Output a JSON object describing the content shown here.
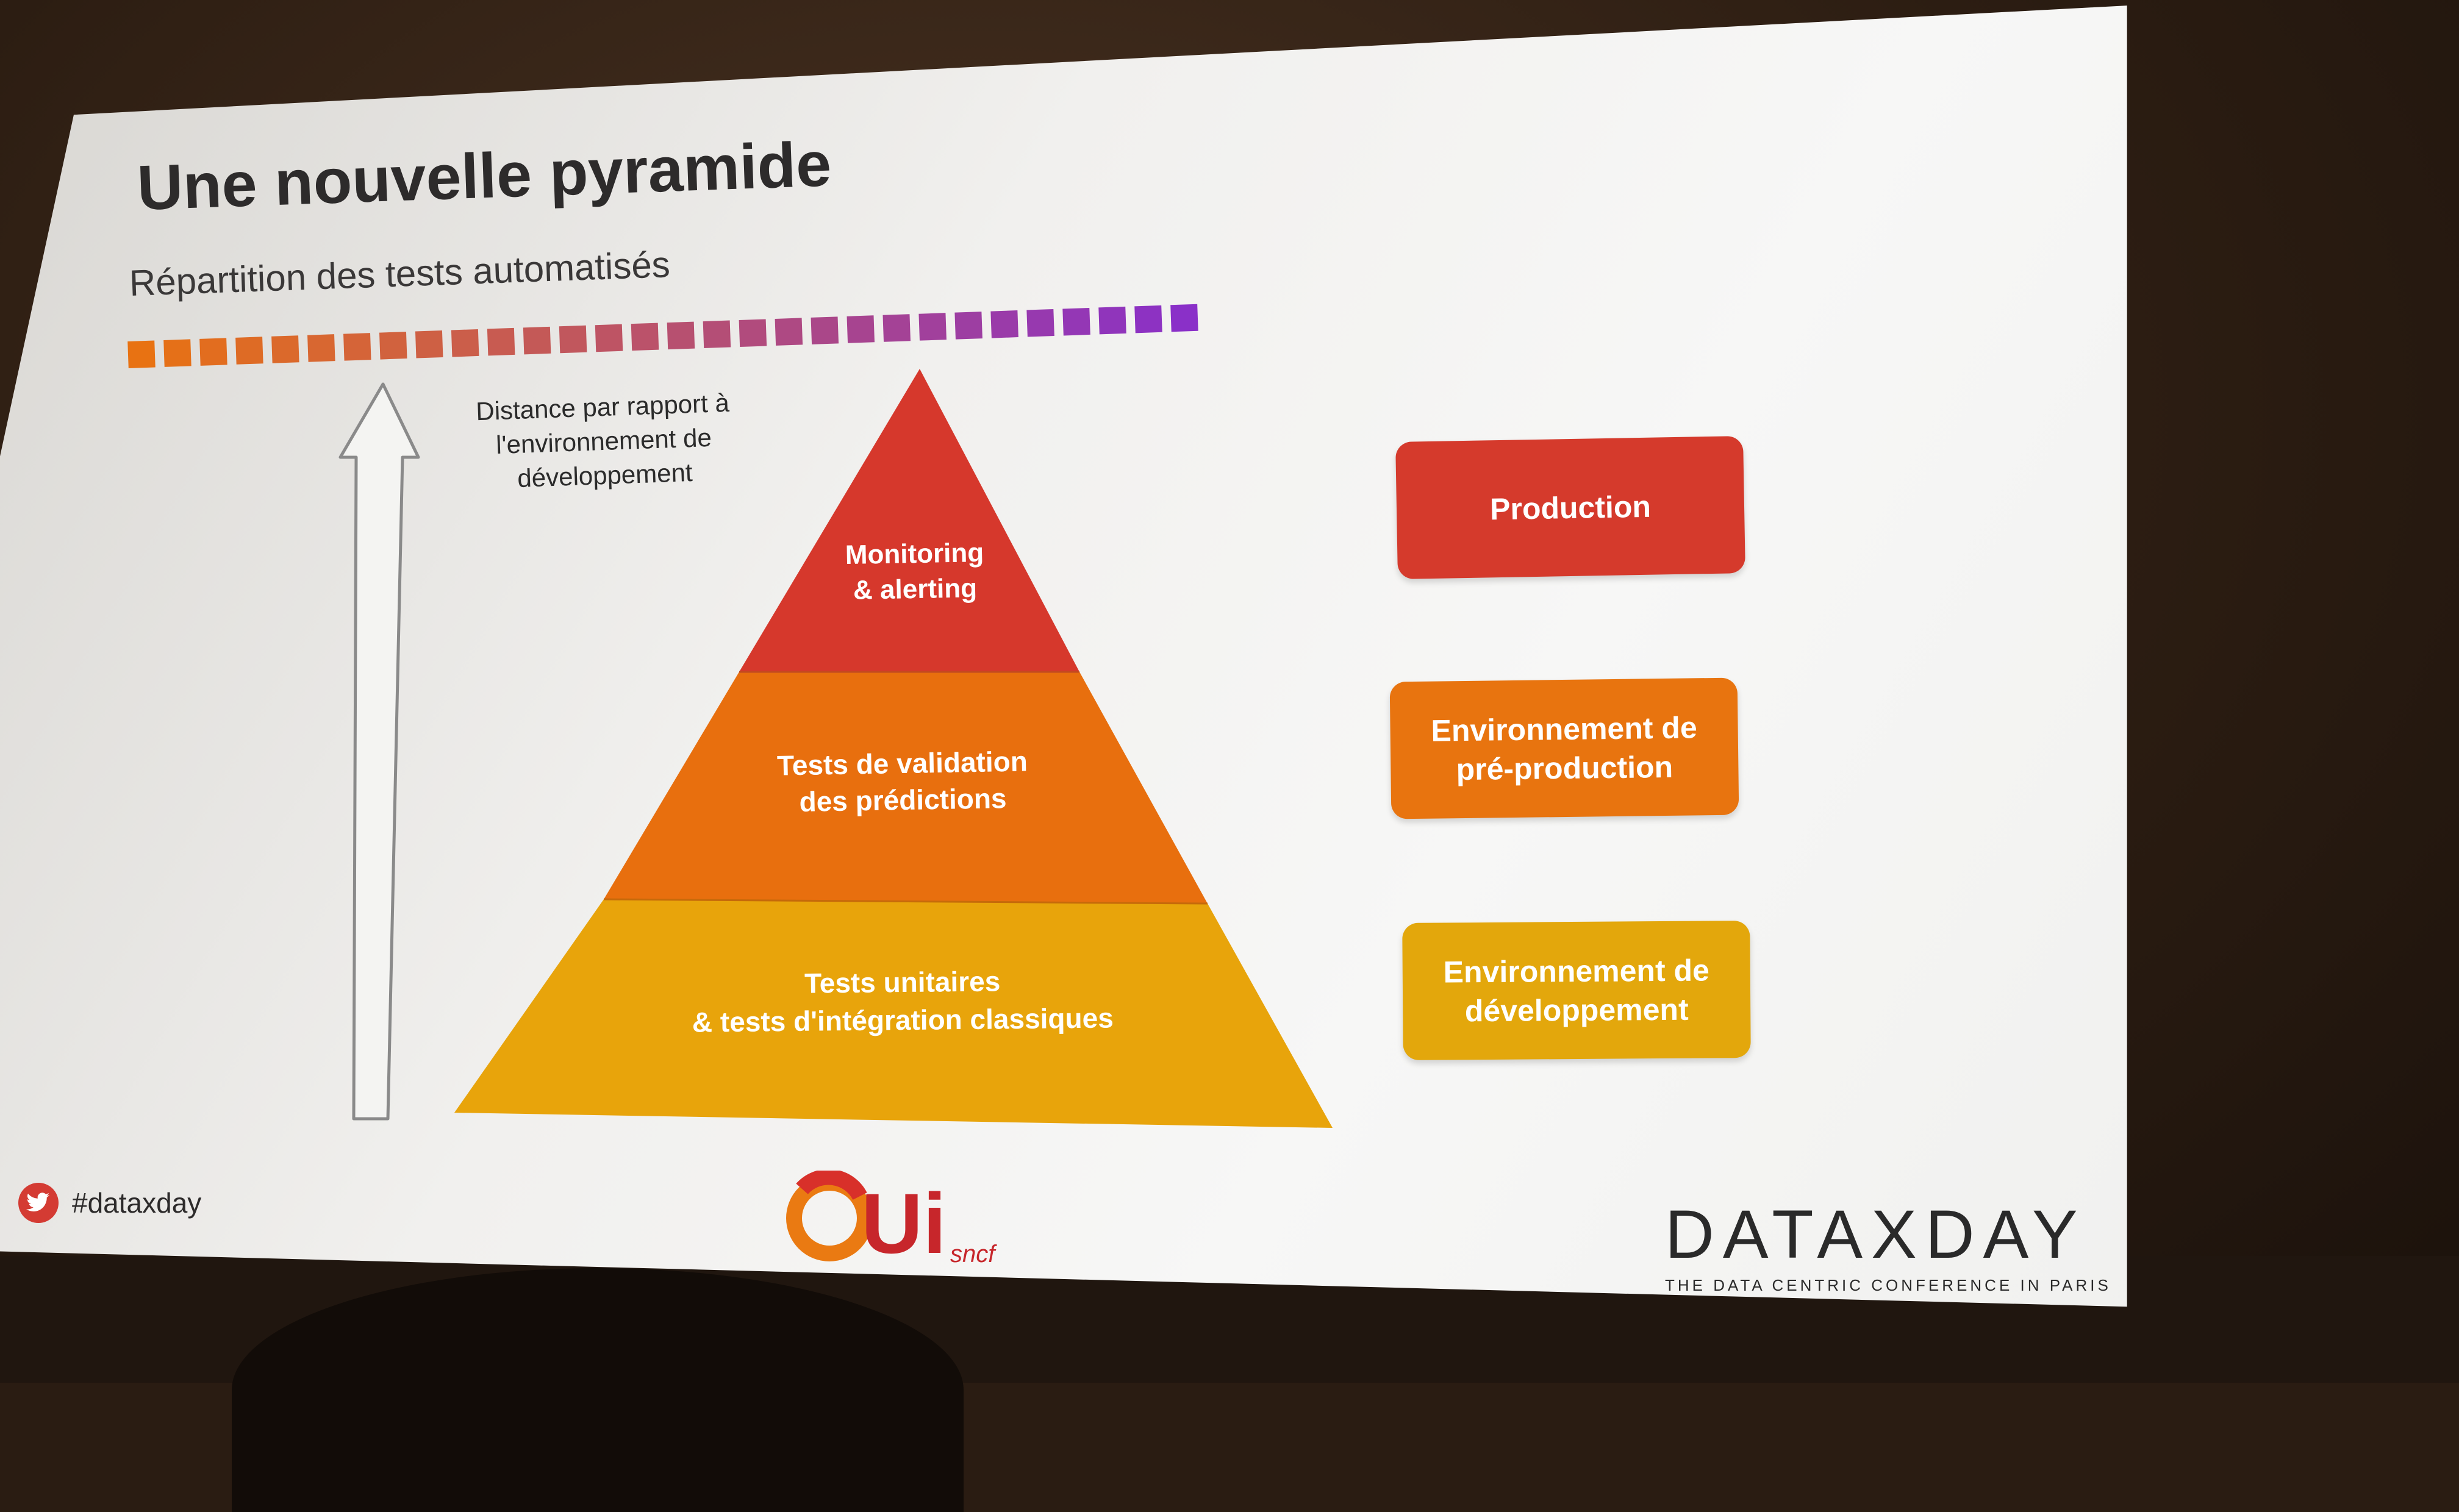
{
  "slide": {
    "title": "Une nouvelle pyramide",
    "subtitle": "Répartition des tests automatisés",
    "arrow_caption": "Distance par rapport à l'environnement de développement",
    "pyramid": {
      "top": "Monitoring\n& alerting",
      "middle": "Tests de validation\ndes prédictions",
      "bottom": "Tests unitaires\n& tests d'intégration classiques"
    },
    "environments": {
      "production": "Production",
      "preproduction": "Environnement de\npré-production",
      "development": "Environnement de\ndéveloppement"
    },
    "footer": {
      "hashtag": "#dataxday",
      "oui_brand": "Ui",
      "oui_sub": "sncf",
      "dataxday_logo": "DATAXDAY",
      "dataxday_tagline": "THE DATA CENTRIC CONFERENCE IN PARIS"
    }
  },
  "colors": {
    "red": "#d53a2c",
    "orange": "#e8740f",
    "yellow": "#e3a70c",
    "gradient_start": "#e87212",
    "gradient_end": "#8a30c8",
    "twitter_badge": "#d43b33"
  },
  "icons": [
    "twitter-icon",
    "up-arrow-icon"
  ]
}
